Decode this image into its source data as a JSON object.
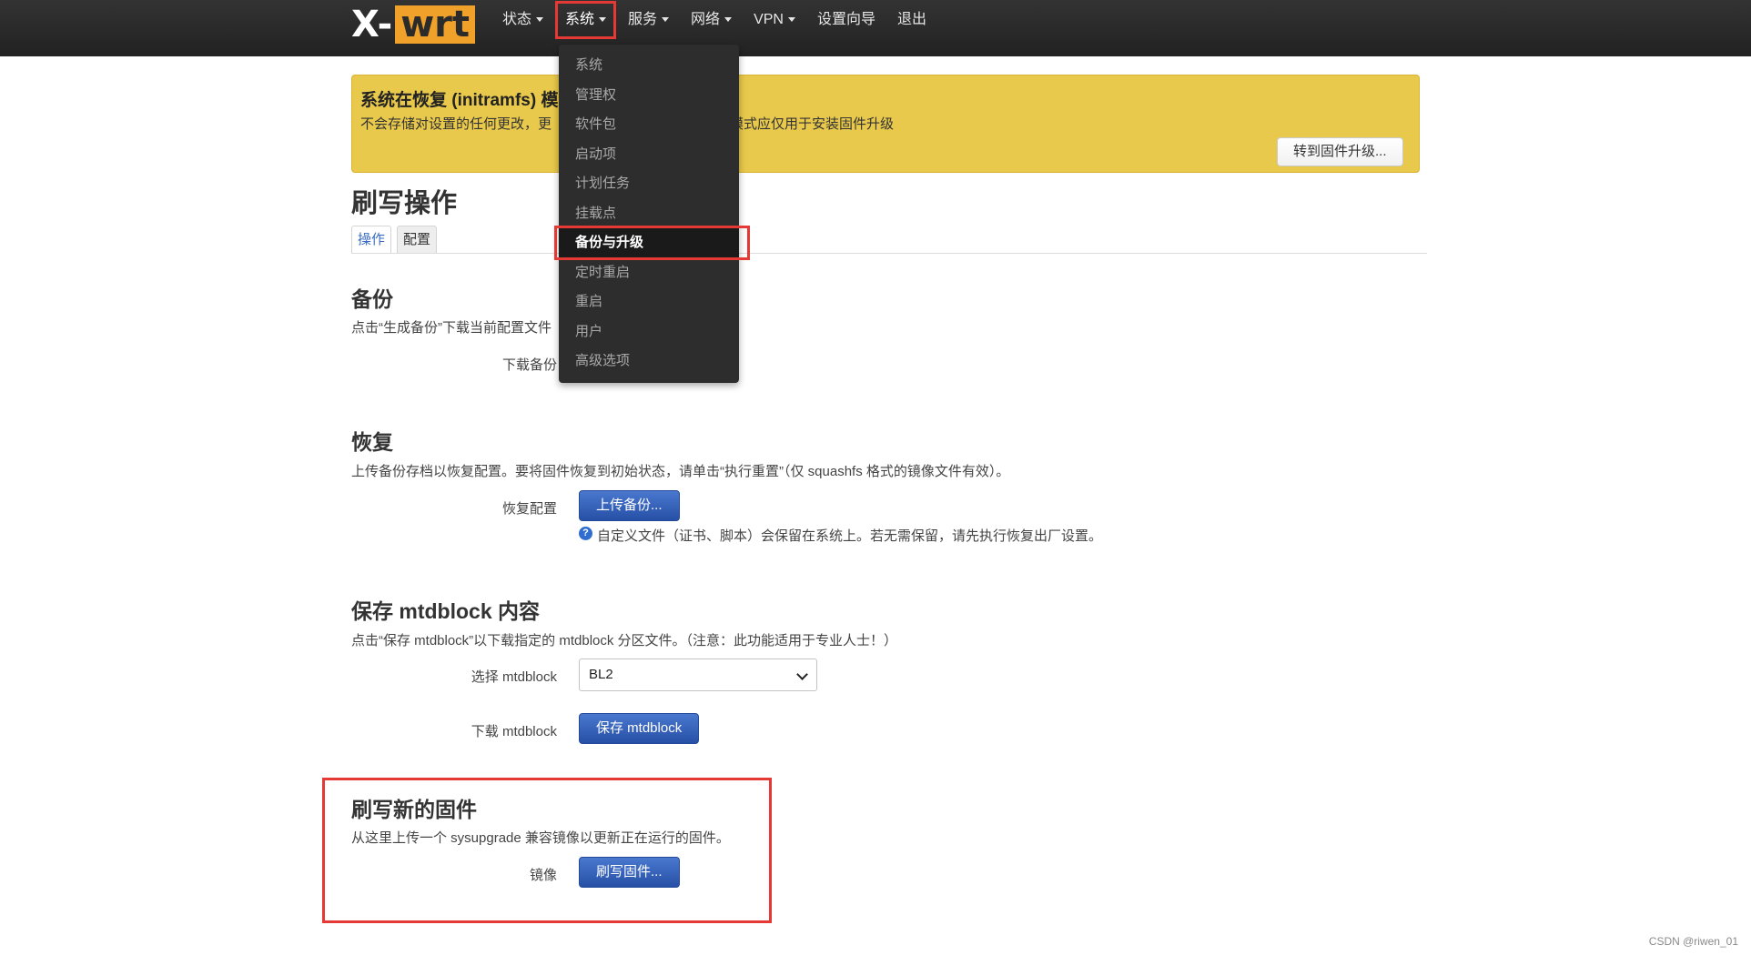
{
  "logo": {
    "part1": "X-",
    "part2": "wrt"
  },
  "nav": [
    {
      "label": "状态",
      "has_caret": true
    },
    {
      "label": "系统",
      "has_caret": true
    },
    {
      "label": "服务",
      "has_caret": true
    },
    {
      "label": "网络",
      "has_caret": true
    },
    {
      "label": "VPN",
      "has_caret": true
    },
    {
      "label": "设置向导",
      "has_caret": false
    },
    {
      "label": "退出",
      "has_caret": false
    }
  ],
  "system_menu": [
    "系统",
    "管理权",
    "软件包",
    "启动项",
    "计划任务",
    "挂载点",
    "备份与升级",
    "定时重启",
    "重启",
    "用户",
    "高级选项"
  ],
  "selected_menu_item": "备份与升级",
  "alert": {
    "title": "系统在恢复 (initramfs) 模",
    "text_left": "不会存储对设置的任何更改，更",
    "text_right": "此模式应仅用于安装固件升级",
    "button": "转到固件升级..."
  },
  "page": {
    "title": "刷写操作",
    "tabs": [
      "操作",
      "配置"
    ]
  },
  "backup": {
    "title": "备份",
    "desc": "点击“生成备份”下载当前配置文件",
    "label": "下载备份"
  },
  "restore": {
    "title": "恢复",
    "desc": "上传备份存档以恢复配置。要将固件恢复到初始状态，请单击“执行重置”（仅 squashfs 格式的镜像文件有效）。",
    "label": "恢复配置",
    "button": "上传备份...",
    "help_icon": "?",
    "help": "自定义文件（证书、脚本）会保留在系统上。若无需保留，请先执行恢复出厂设置。"
  },
  "mtdblock": {
    "title": "保存 mtdblock 内容",
    "desc": "点击“保存 mtdblock”以下载指定的 mtdblock 分区文件。（注意：此功能适用于专业人士！）",
    "select_label": "选择 mtdblock",
    "select_value": "BL2",
    "download_label": "下载 mtdblock",
    "button": "保存 mtdblock"
  },
  "flash": {
    "title": "刷写新的固件",
    "desc": "从这里上传一个 sysupgrade 兼容镜像以更新正在运行的固件。",
    "label": "镜像",
    "button": "刷写固件..."
  },
  "watermark": "CSDN @riwen_01",
  "colors": {
    "topbar": "#2a2a2a",
    "logo_accent": "#f0a12a",
    "alert_bg": "#e8c94b",
    "primary_button": "#2f5bb5",
    "annotation_red": "#e53935"
  }
}
